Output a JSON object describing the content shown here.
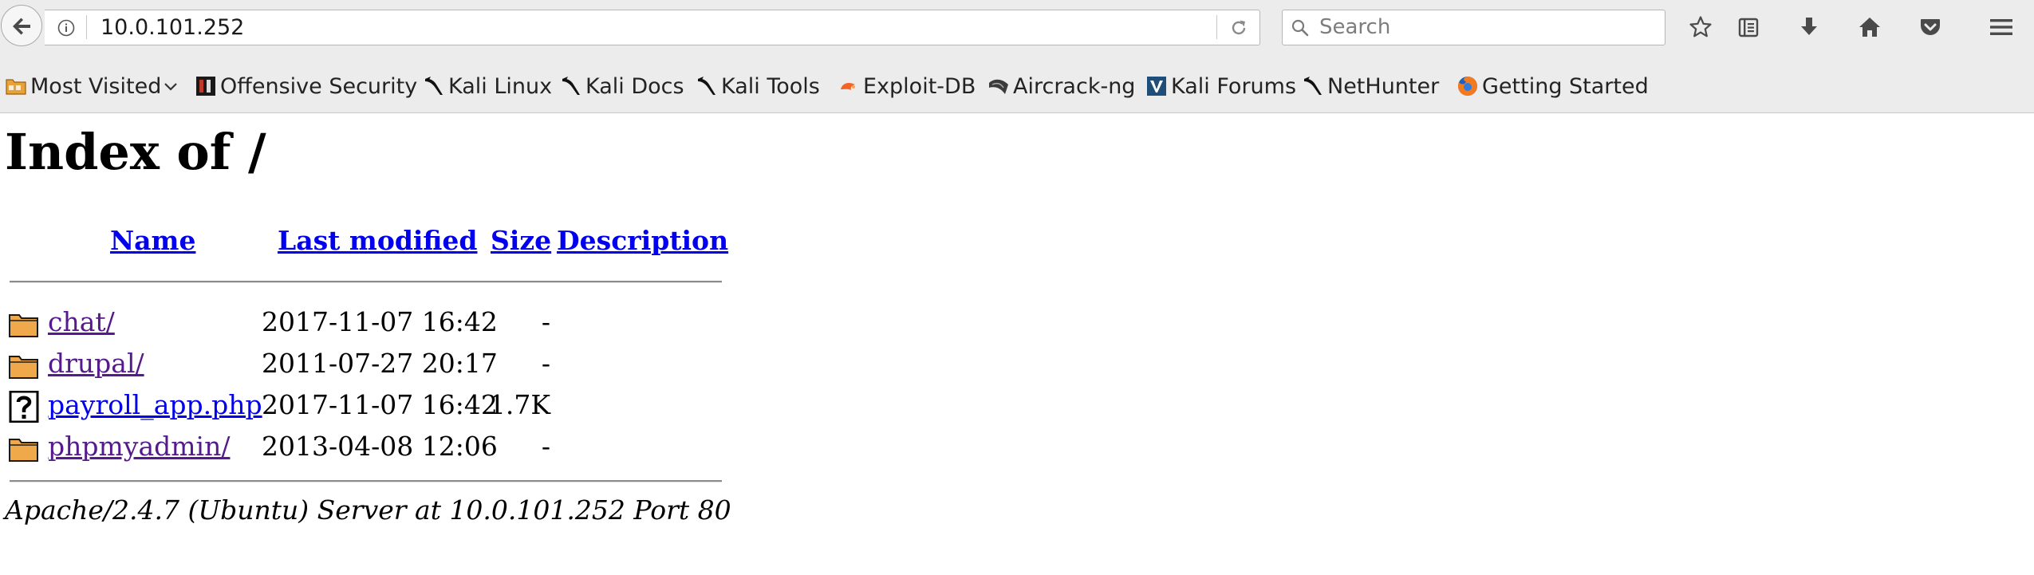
{
  "browser": {
    "url": "10.0.101.252",
    "search_placeholder": "Search",
    "toolbar_icons": [
      "star-icon",
      "reading-list-icon",
      "download-icon",
      "home-icon",
      "pocket-icon",
      "menu-icon"
    ]
  },
  "bookmarks": [
    {
      "label": "Most Visited",
      "icon": "folder-icon",
      "has_dropdown": true
    },
    {
      "label": "Offensive Security",
      "icon": "offsec-icon"
    },
    {
      "label": "Kali Linux",
      "icon": "kali-dragon-icon"
    },
    {
      "label": "Kali Docs",
      "icon": "kali-dragon-icon"
    },
    {
      "label": "Kali Tools",
      "icon": "kali-dragon-icon"
    },
    {
      "label": "Exploit-DB",
      "icon": "exploitdb-icon"
    },
    {
      "label": "Aircrack-ng",
      "icon": "aircrack-icon"
    },
    {
      "label": "Kali Forums",
      "icon": "kali-forums-icon"
    },
    {
      "label": "NetHunter",
      "icon": "kali-dragon-icon"
    },
    {
      "label": "Getting Started",
      "icon": "firefox-icon"
    }
  ],
  "page": {
    "title": "Index of /",
    "columns": {
      "name": "Name",
      "last_modified": "Last modified",
      "size": "Size",
      "description": "Description"
    },
    "rows": [
      {
        "icon": "folder-icon",
        "name": "chat/",
        "last_modified": "2017-11-07 16:42",
        "size": "-",
        "description": "",
        "visited": true
      },
      {
        "icon": "folder-icon",
        "name": "drupal/",
        "last_modified": "2011-07-27 20:17",
        "size": "-",
        "description": "",
        "visited": true
      },
      {
        "icon": "unknown-file-icon",
        "name": "payroll_app.php",
        "last_modified": "2017-11-07 16:42",
        "size": "1.7K",
        "description": "",
        "visited": false
      },
      {
        "icon": "folder-icon",
        "name": "phpmyadmin/",
        "last_modified": "2013-04-08 12:06",
        "size": "-",
        "description": "",
        "visited": true
      }
    ],
    "server_signature": "Apache/2.4.7 (Ubuntu) Server at 10.0.101.252 Port 80"
  },
  "colors": {
    "link": "#0000ee",
    "visited_link": "#551a8b",
    "chrome_bg": "#ececec"
  }
}
